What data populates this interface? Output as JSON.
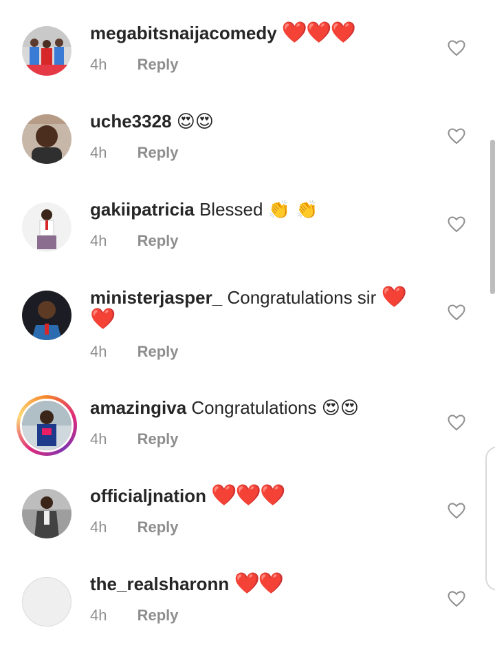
{
  "comments": [
    {
      "username": "megabitsnaijacomedy",
      "text": "",
      "emoji": "❤️❤️❤️",
      "time": "4h",
      "reply_label": "Reply",
      "avatar_icon": "group-photo",
      "like_icon": "heart-outline-icon"
    },
    {
      "username": "uche3328",
      "text": "",
      "emoji": "😍😍",
      "time": "4h",
      "reply_label": "Reply",
      "avatar_icon": "portrait-photo",
      "like_icon": "heart-outline-icon"
    },
    {
      "username": "gakiipatricia",
      "text": "Blessed",
      "emoji": "👏 👏",
      "time": "4h",
      "reply_label": "Reply",
      "avatar_icon": "portrait-photo",
      "like_icon": "heart-outline-icon"
    },
    {
      "username": "ministerjasper_",
      "text": "Congratulations sir",
      "emoji": "❤️ ❤️",
      "time": "4h",
      "reply_label": "Reply",
      "avatar_icon": "portrait-photo",
      "like_icon": "heart-outline-icon"
    },
    {
      "username": "amazingiva",
      "text": "Congratulations",
      "emoji": "😍😍",
      "time": "4h",
      "reply_label": "Reply",
      "avatar_icon": "story-ring-photo",
      "like_icon": "heart-outline-icon"
    },
    {
      "username": "officialjnation",
      "text": "",
      "emoji": "❤️❤️❤️",
      "time": "4h",
      "reply_label": "Reply",
      "avatar_icon": "portrait-photo",
      "like_icon": "heart-outline-icon"
    },
    {
      "username": "the_realsharonn",
      "text": "",
      "emoji": "❤️❤️",
      "time": "4h",
      "reply_label": "Reply",
      "avatar_icon": "blank-avatar",
      "like_icon": "heart-outline-icon"
    }
  ],
  "colors": {
    "text": "#262626",
    "meta": "#8e8e8e",
    "heart": "#ed1c24",
    "like_outline": "#8e8e8e"
  }
}
